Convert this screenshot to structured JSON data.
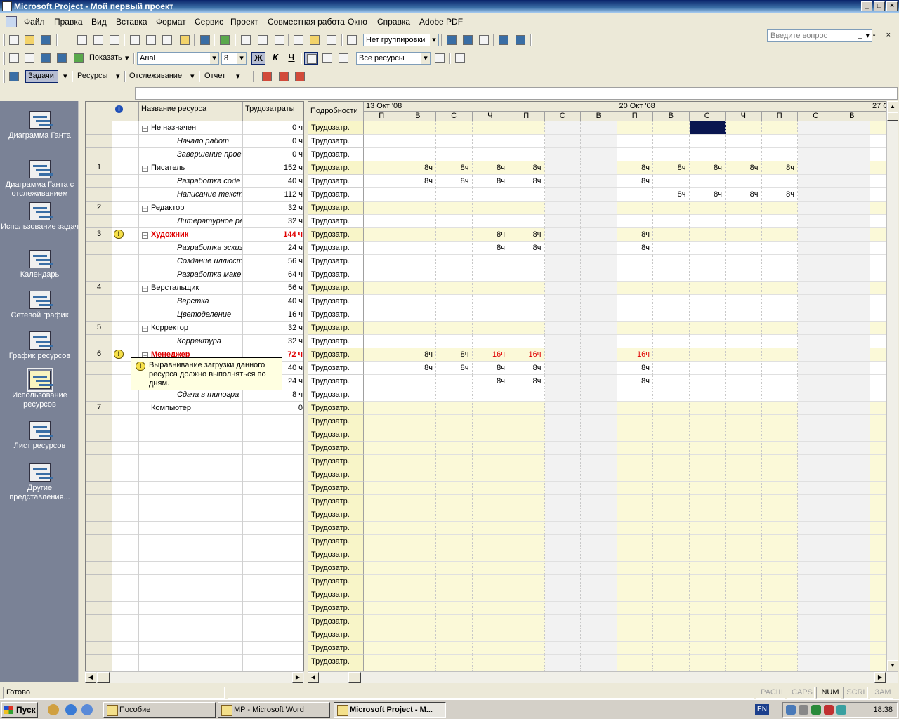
{
  "window": {
    "title": "Microsoft Project - Мой первый проект",
    "ask_placeholder": "Введите вопрос"
  },
  "menu": [
    "Файл",
    "Правка",
    "Вид",
    "Вставка",
    "Формат",
    "Сервис",
    "Проект",
    "Совместная работа",
    "Окно",
    "Справка",
    "Adobe PDF"
  ],
  "toolbar": {
    "grouping": "Нет группировки",
    "show_label": "Показать",
    "font": "Arial",
    "font_size": "8",
    "bold": "Ж",
    "italic": "К",
    "underline": "Ч",
    "filter": "Все ресурсы"
  },
  "guide_toolbar": {
    "tasks": "Задачи",
    "resources": "Ресурсы",
    "tracking": "Отслеживание",
    "report": "Отчет"
  },
  "viewbar": [
    {
      "label": "Диаграмма Ганта",
      "icon": "gantt-chart-icon"
    },
    {
      "label": "Диаграмма Ганта с отслеживанием",
      "icon": "tracking-gantt-icon"
    },
    {
      "label": "Использование задач",
      "icon": "task-usage-icon"
    },
    {
      "label": "Календарь",
      "icon": "calendar-icon"
    },
    {
      "label": "Сетевой график",
      "icon": "network-diagram-icon"
    },
    {
      "label": "График ресурсов",
      "icon": "resource-graph-icon"
    },
    {
      "label": "Использование ресурсов",
      "icon": "resource-usage-icon",
      "active": true
    },
    {
      "label": "Лист ресурсов",
      "icon": "resource-sheet-icon"
    },
    {
      "label": "Другие представления...",
      "icon": "more-views-icon"
    }
  ],
  "sheet": {
    "col_name": "Название ресурса",
    "col_work": "Трудозатраты",
    "indicator_icon": "info-icon",
    "rows": [
      {
        "id": "",
        "name": "Не назначен",
        "work": "0 ч",
        "type": "group"
      },
      {
        "id": "",
        "name": "Начало работ",
        "work": "0 ч",
        "type": "sub"
      },
      {
        "id": "",
        "name": "Завершение прое",
        "work": "0 ч",
        "type": "sub"
      },
      {
        "id": "1",
        "name": "Писатель",
        "work": "152 ч",
        "type": "group"
      },
      {
        "id": "",
        "name": "Разработка соде",
        "work": "40 ч",
        "type": "sub"
      },
      {
        "id": "",
        "name": "Написание текст",
        "work": "112 ч",
        "type": "sub"
      },
      {
        "id": "2",
        "name": "Редактор",
        "work": "32 ч",
        "type": "group"
      },
      {
        "id": "",
        "name": "Литературное ре",
        "work": "32 ч",
        "type": "sub"
      },
      {
        "id": "3",
        "name": "Художник",
        "work": "144 ч",
        "type": "group",
        "over": true
      },
      {
        "id": "",
        "name": "Разработка эскиз",
        "work": "24 ч",
        "type": "sub"
      },
      {
        "id": "",
        "name": "Создание иллюст",
        "work": "56 ч",
        "type": "sub"
      },
      {
        "id": "",
        "name": "Разработка маке",
        "work": "64 ч",
        "type": "sub"
      },
      {
        "id": "4",
        "name": "Верстальщик",
        "work": "56 ч",
        "type": "group"
      },
      {
        "id": "",
        "name": "Верстка",
        "work": "40 ч",
        "type": "sub"
      },
      {
        "id": "",
        "name": "Цветоделение",
        "work": "16 ч",
        "type": "sub"
      },
      {
        "id": "5",
        "name": "Корректор",
        "work": "32 ч",
        "type": "group"
      },
      {
        "id": "",
        "name": "Корректура",
        "work": "32 ч",
        "type": "sub"
      },
      {
        "id": "6",
        "name": "Менеджер",
        "work": "72 ч",
        "type": "group",
        "over": true
      },
      {
        "id": "",
        "name": "",
        "work": "40 ч",
        "type": "sub"
      },
      {
        "id": "",
        "name": "",
        "work": "24 ч",
        "type": "sub"
      },
      {
        "id": "",
        "name": "Сдача в типогра",
        "work": "8 ч",
        "type": "sub"
      },
      {
        "id": "7",
        "name": "Компьютер",
        "work": "0",
        "type": "plain"
      }
    ]
  },
  "tooltip": "Выравнивание загрузки данного ресурса должно выполняться по дням.",
  "grid": {
    "details_header": "Подробности",
    "detail_label": "Трудозатр.",
    "weeks": [
      "13 Окт '08",
      "20 Окт '08",
      "27 О"
    ],
    "days": [
      "П",
      "В",
      "С",
      "Ч",
      "П",
      "С",
      "В",
      "П",
      "В",
      "С",
      "Ч",
      "П",
      "С",
      "В",
      "П"
    ],
    "row_values": [
      [],
      [],
      [],
      [
        "",
        "8ч",
        "8ч",
        "8ч",
        "8ч",
        "",
        "",
        "8ч",
        "8ч",
        "8ч",
        "8ч",
        "8ч"
      ],
      [
        "",
        "8ч",
        "8ч",
        "8ч",
        "8ч",
        "",
        "",
        "8ч"
      ],
      [
        "",
        "",
        "",
        "",
        "",
        "",
        "",
        "",
        "8ч",
        "8ч",
        "8ч",
        "8ч"
      ],
      [],
      [],
      [
        "",
        "",
        "",
        "8ч",
        "8ч",
        "",
        "",
        "8ч"
      ],
      [
        "",
        "",
        "",
        "8ч",
        "8ч",
        "",
        "",
        "8ч"
      ],
      [],
      [],
      [],
      [],
      [],
      [],
      [],
      [
        "",
        "8ч",
        "8ч",
        "16ч",
        "16ч",
        "",
        "",
        "16ч"
      ],
      [
        "",
        "8ч",
        "8ч",
        "8ч",
        "8ч",
        "",
        "",
        "8ч"
      ],
      [
        "",
        "",
        "",
        "8ч",
        "8ч",
        "",
        "",
        "8ч"
      ],
      []
    ],
    "over_cells": [
      [
        17,
        3
      ],
      [
        17,
        4
      ],
      [
        17,
        7
      ]
    ],
    "empty_row_count": 20
  },
  "status": {
    "ready": "Готово",
    "ext": "РАСШ",
    "caps": "CAPS",
    "num": "NUM",
    "scrl": "SCRL",
    "ovr": "ЗАМ"
  },
  "taskbar": {
    "start": "Пуск",
    "tasks": [
      {
        "label": "Пособие",
        "active": false
      },
      {
        "label": "MP - Microsoft Word",
        "active": false
      },
      {
        "label": "Microsoft Project - М...",
        "active": true
      }
    ],
    "lang": "EN",
    "clock": "18:38"
  }
}
